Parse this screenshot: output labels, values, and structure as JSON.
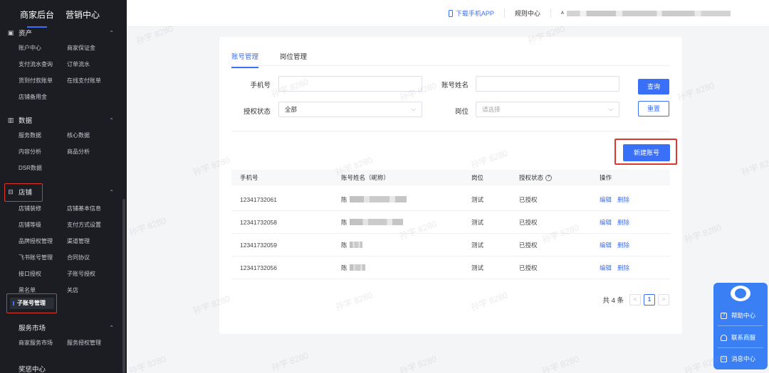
{
  "sidebar": {
    "top_tabs": [
      "商家后台",
      "营销中心"
    ],
    "asset_section": {
      "title": "资产",
      "items": [
        "账户中心",
        "商家保证金",
        "支付流水查询",
        "订单流水",
        "货到付款账单",
        "在线支付账单",
        "店铺备用金"
      ]
    },
    "data_section": {
      "title": "数据",
      "items": [
        "服务数据",
        "核心数据",
        "内容分析",
        "商品分析",
        "DSR数据"
      ]
    },
    "store_section": {
      "title": "店铺",
      "items": [
        "店铺装修",
        "店铺基本信息",
        "店铺等级",
        "支付方式设置",
        "品牌授权管理",
        "渠道管理",
        "飞书账号管理",
        "合同协议",
        "接口授权",
        "子账号授权",
        "黑名单",
        "关店"
      ],
      "active_item": "子账号管理"
    },
    "service_section": {
      "title": "服务市场",
      "items": [
        "商家服务市场",
        "服务授权管理"
      ]
    },
    "reward_section": {
      "title": "奖惩中心"
    }
  },
  "header": {
    "download_app": "下载手机APP",
    "rules_center": "规则中心"
  },
  "main": {
    "tabs": [
      "账号管理",
      "岗位管理"
    ],
    "filters": {
      "phone_label": "手机号",
      "account_name_label": "账号姓名",
      "auth_status_label": "授权状态",
      "auth_status_value": "全部",
      "position_label": "岗位",
      "position_placeholder": "请选择"
    },
    "query_button": "查询",
    "reset_button": "重置",
    "new_account_button": "新建账号",
    "table": {
      "headers": [
        "手机号",
        "账号姓名（昵称）",
        "岗位",
        "授权状态",
        "操作"
      ],
      "rows": [
        {
          "phone": "12341732061",
          "name": "陈",
          "position": "测试",
          "status": "已授权",
          "edit": "编辑",
          "delete": "删除"
        },
        {
          "phone": "12341732058",
          "name": "陈",
          "position": "测试",
          "status": "已授权",
          "edit": "编辑",
          "delete": "删除"
        },
        {
          "phone": "12341732059",
          "name": "陈",
          "position": "测试",
          "status": "已授权",
          "edit": "编辑",
          "delete": "删除"
        },
        {
          "phone": "12341732056",
          "name": "陈",
          "position": "测试",
          "status": "已授权",
          "edit": "编辑",
          "delete": "删除"
        }
      ]
    },
    "pagination": {
      "total": "共 4 条",
      "current_page": "1",
      "prev": "<",
      "next": ">"
    }
  },
  "float_panel": {
    "help_center": "帮助中心",
    "contact": "联系商服",
    "messages": "消息中心"
  },
  "watermark": "孙宇 8280",
  "colors": {
    "accent": "#3a6ff8",
    "sidebar_bg": "#1b1d22",
    "highlight_red": "#e0352b"
  }
}
